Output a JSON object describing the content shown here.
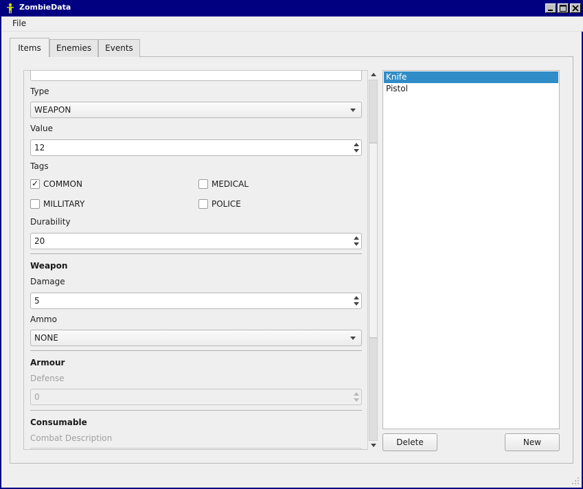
{
  "window": {
    "title": "ZombieData"
  },
  "menubar": {
    "file_label": "File"
  },
  "tabs": [
    {
      "label": "Items",
      "active": true
    },
    {
      "label": "Enemies",
      "active": false
    },
    {
      "label": "Events",
      "active": false
    }
  ],
  "form": {
    "type_label": "Type",
    "type_value": "WEAPON",
    "value_label": "Value",
    "value_value": "12",
    "tags_label": "Tags",
    "tags": [
      {
        "label": "COMMON",
        "checked": true
      },
      {
        "label": "MEDICAL",
        "checked": false
      },
      {
        "label": "MILLITARY",
        "checked": false
      },
      {
        "label": "POLICE",
        "checked": false
      }
    ],
    "durability_label": "Durability",
    "durability_value": "20",
    "weapon_section": "Weapon",
    "damage_label": "Damage",
    "damage_value": "5",
    "ammo_label": "Ammo",
    "ammo_value": "NONE",
    "armour_section": "Armour",
    "defense_label": "Defense",
    "defense_value": "0",
    "consumable_section": "Consumable",
    "combat_description_label": "Combat Description"
  },
  "item_list": {
    "items": [
      {
        "label": "Knife",
        "selected": true
      },
      {
        "label": "Pistol",
        "selected": false
      }
    ],
    "selection_color": "#308cc6"
  },
  "buttons": {
    "delete_label": "Delete",
    "new_label": "New"
  },
  "colors": {
    "titlebar": "#000080",
    "background": "#efefef"
  }
}
